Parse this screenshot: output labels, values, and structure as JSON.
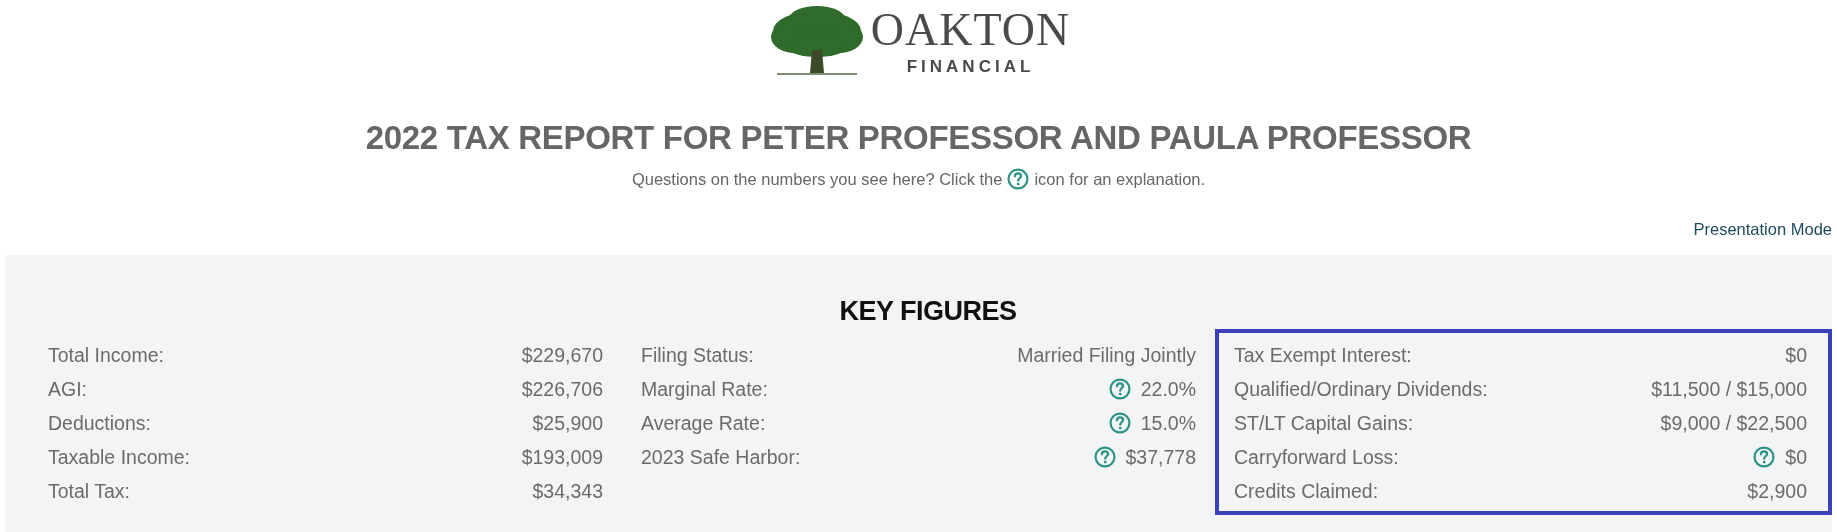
{
  "logo": {
    "name": "OAKTON",
    "subtitle": "FINANCIAL"
  },
  "title": "2022 TAX REPORT FOR PETER PROFESSOR AND PAULA PROFESSOR",
  "intro": {
    "before": "Questions on the numbers you see here? Click the",
    "after": "icon for an explanation."
  },
  "presentation_link": "Presentation Mode",
  "key_figures": {
    "heading": "KEY FIGURES",
    "columns": [
      {
        "highlighted": false,
        "rows": [
          {
            "label": "Total Income:",
            "value": "$229,670",
            "help": false
          },
          {
            "label": "AGI:",
            "value": "$226,706",
            "help": false
          },
          {
            "label": "Deductions:",
            "value": "$25,900",
            "help": false
          },
          {
            "label": "Taxable Income:",
            "value": "$193,009",
            "help": false
          },
          {
            "label": "Total Tax:",
            "value": "$34,343",
            "help": false
          }
        ]
      },
      {
        "highlighted": false,
        "rows": [
          {
            "label": "Filing Status:",
            "value": "Married Filing Jointly",
            "help": false
          },
          {
            "label": "Marginal Rate:",
            "value": "22.0%",
            "help": true
          },
          {
            "label": "Average Rate:",
            "value": "15.0%",
            "help": true
          },
          {
            "label": "2023 Safe Harbor:",
            "value": "$37,778",
            "help": true
          }
        ]
      },
      {
        "highlighted": true,
        "rows": [
          {
            "label": "Tax Exempt Interest:",
            "value": "$0",
            "help": false
          },
          {
            "label": "Qualified/Ordinary Dividends:",
            "value": "$11,500 / $15,000",
            "help": false
          },
          {
            "label": "ST/LT Capital Gains:",
            "value": "$9,000 / $22,500",
            "help": false
          },
          {
            "label": "Carryforward Loss:",
            "value": "$0",
            "help": true
          },
          {
            "label": "Credits Claimed:",
            "value": "$2,900",
            "help": false
          }
        ]
      }
    ]
  }
}
